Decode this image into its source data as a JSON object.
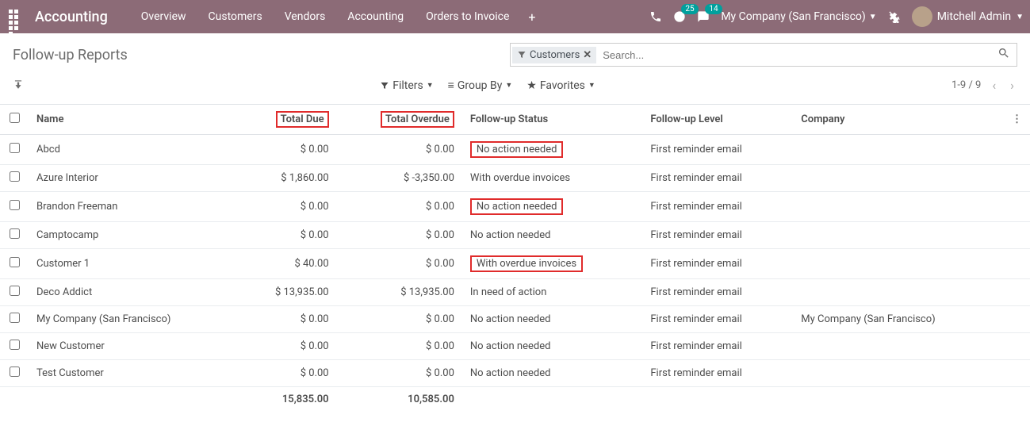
{
  "header": {
    "brand": "Accounting",
    "menu": [
      "Overview",
      "Customers",
      "Vendors",
      "Accounting",
      "Orders to Invoice"
    ],
    "activities_badge": "25",
    "discuss_badge": "14",
    "company": "My Company (San Francisco)",
    "user": "Mitchell Admin"
  },
  "page": {
    "title": "Follow-up Reports",
    "search_chip": "Customers",
    "search_placeholder": "Search...",
    "filters_label": "Filters",
    "groupby_label": "Group By",
    "favorites_label": "Favorites",
    "pager": "1-9 / 9"
  },
  "columns": {
    "name": "Name",
    "total_due": "Total Due",
    "total_overdue": "Total Overdue",
    "status": "Follow-up Status",
    "level": "Follow-up Level",
    "company": "Company"
  },
  "rows": [
    {
      "name": "Abcd",
      "due": "$ 0.00",
      "overdue": "$ 0.00",
      "status": "No action needed",
      "status_boxed": true,
      "level": "First reminder email",
      "company": ""
    },
    {
      "name": "Azure Interior",
      "due": "$ 1,860.00",
      "overdue": "$ -3,350.00",
      "status": "With overdue invoices",
      "status_boxed": false,
      "level": "First reminder email",
      "company": ""
    },
    {
      "name": "Brandon Freeman",
      "due": "$ 0.00",
      "overdue": "$ 0.00",
      "status": "No action needed",
      "status_boxed": true,
      "level": "First reminder email",
      "company": ""
    },
    {
      "name": "Camptocamp",
      "due": "$ 0.00",
      "overdue": "$ 0.00",
      "status": "No action needed",
      "status_boxed": false,
      "level": "First reminder email",
      "company": ""
    },
    {
      "name": "Customer 1",
      "due": "$ 40.00",
      "overdue": "$ 0.00",
      "status": "With overdue invoices",
      "status_boxed": true,
      "level": "First reminder email",
      "company": ""
    },
    {
      "name": "Deco Addict",
      "due": "$ 13,935.00",
      "overdue": "$ 13,935.00",
      "status": "In need of action",
      "status_boxed": false,
      "level": "First reminder email",
      "company": ""
    },
    {
      "name": "My Company (San Francisco)",
      "due": "$ 0.00",
      "overdue": "$ 0.00",
      "status": "No action needed",
      "status_boxed": false,
      "level": "First reminder email",
      "company": "My Company (San Francisco)"
    },
    {
      "name": "New Customer",
      "due": "$ 0.00",
      "overdue": "$ 0.00",
      "status": "No action needed",
      "status_boxed": false,
      "level": "First reminder email",
      "company": ""
    },
    {
      "name": "Test Customer",
      "due": "$ 0.00",
      "overdue": "$ 0.00",
      "status": "No action needed",
      "status_boxed": false,
      "level": "First reminder email",
      "company": ""
    }
  ],
  "totals": {
    "due": "15,835.00",
    "overdue": "10,585.00"
  }
}
